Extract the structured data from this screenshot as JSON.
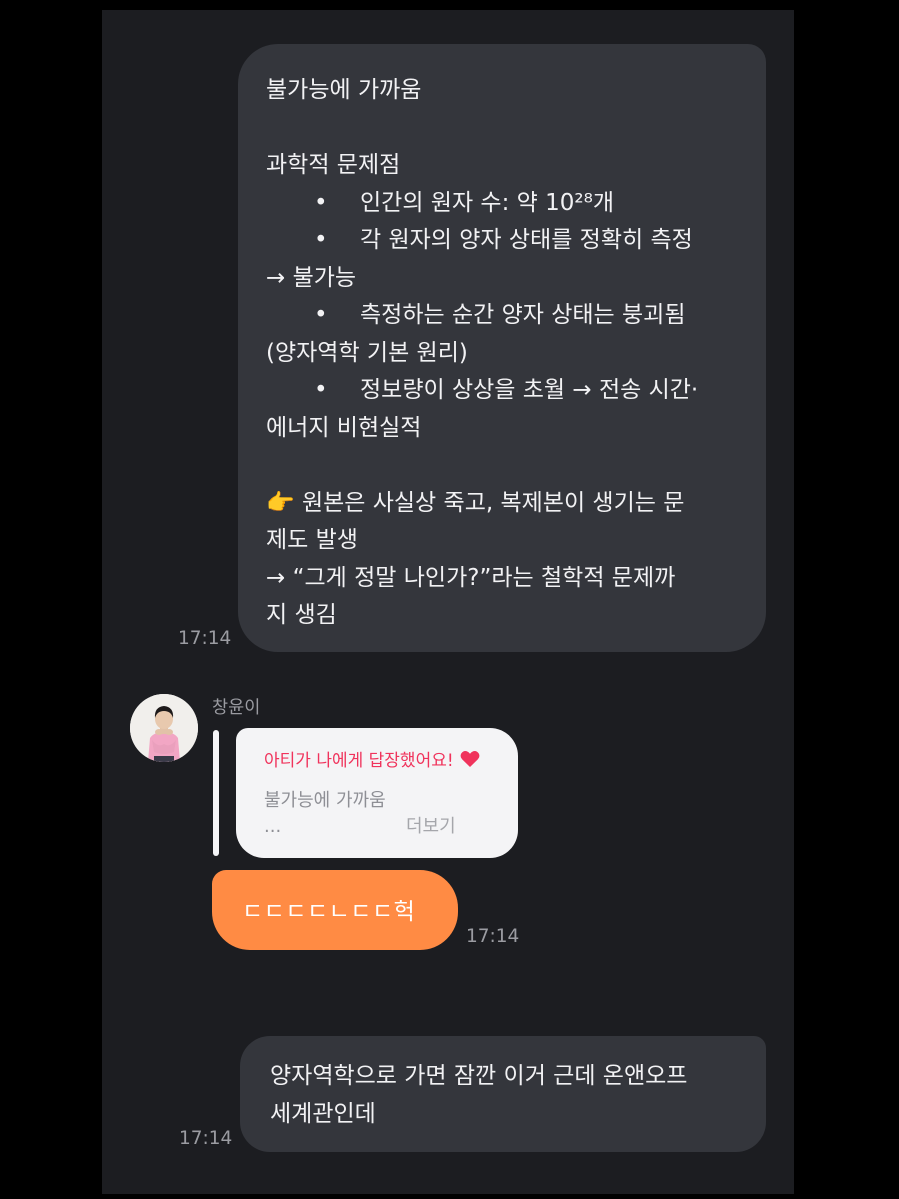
{
  "messages": [
    {
      "direction": "outgoing",
      "time": "17:14",
      "lines": [
        {
          "text": "불가능에 가까움",
          "bullet": false
        },
        {
          "text": "",
          "bullet": false
        },
        {
          "text": "과학적 문제점",
          "bullet": false
        },
        {
          "text": "인간의 원자 수: 약 10²⁸개",
          "bullet": true
        },
        {
          "text": "각 원자의 양자 상태를 정확히 측정",
          "bullet": true
        },
        {
          "text": "→ 불가능",
          "bullet": false
        },
        {
          "text": "측정하는 순간 양자 상태는 붕괴됨",
          "bullet": true
        },
        {
          "text": "(양자역학 기본 원리)",
          "bullet": false
        },
        {
          "text": "정보량이 상상을 초월 → 전송 시간·",
          "bullet": true
        },
        {
          "text": "에너지 비현실적",
          "bullet": false
        },
        {
          "text": "",
          "bullet": false
        },
        {
          "text": "👉 원본은 사실상 죽고, 복제본이 생기는 문",
          "bullet": false
        },
        {
          "text": "제도 발생",
          "bullet": false
        },
        {
          "text": "→ “그게 정말 나인가?”라는 철학적 문제까",
          "bullet": false
        },
        {
          "text": "지 생김",
          "bullet": false
        }
      ]
    },
    {
      "direction": "incoming",
      "sender": "창윤이",
      "avatar_icon": "profile-photo-avatar",
      "reply": {
        "header": "아티가 나에게 답장했어요!",
        "header_color": "#f0335c",
        "heart_icon": "heart-icon",
        "quoted_text": "불가능에 가까움",
        "ellipsis": "...",
        "more_label": "더보기"
      },
      "text": "ㄷㄷㄷㄷㄴㄷㄷ헉",
      "bubble_color": "#ff8b44",
      "time": "17:14"
    },
    {
      "direction": "outgoing",
      "time": "17:14",
      "lines": [
        {
          "text": "양자역학으로 가면 잠깐 이거 근데 온앤오프"
        },
        {
          "text": "세계관인데"
        }
      ]
    }
  ]
}
